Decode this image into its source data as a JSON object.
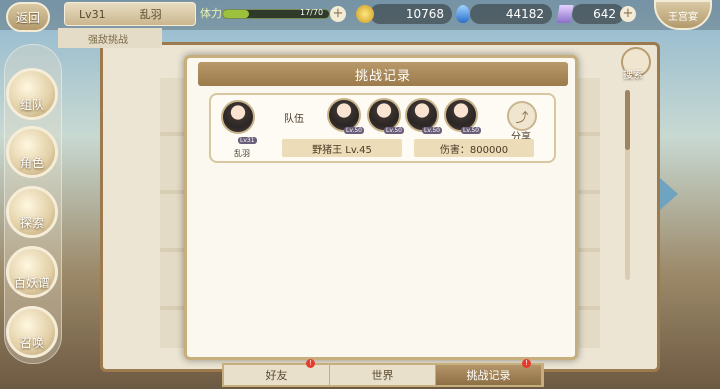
{
  "top": {
    "back_label": "返回",
    "player_level": "Lv31",
    "player_name": "乱羽",
    "stamina_label": "体力",
    "stamina_text": "17/70",
    "stamina_fraction": 0.243,
    "gold": "10768",
    "water": "44182",
    "gem": "642",
    "sub_tab": "强敌挑战",
    "right_btn": "王宫宴"
  },
  "side_menu": [
    {
      "label": "组队",
      "icon": "cat-icon"
    },
    {
      "label": "角色",
      "icon": "character-icon"
    },
    {
      "label": "探索",
      "icon": "explore-icon"
    },
    {
      "label": "百妖谱",
      "icon": "book-icon"
    },
    {
      "label": "召唤",
      "icon": "summon-icon"
    }
  ],
  "search_label": "搜索",
  "modal": {
    "title": "挑战记录",
    "record": {
      "player_name": "乱羽",
      "player_level": "Lv31",
      "team_label": "队伍",
      "team_levels": [
        "Lv.50",
        "Lv.50",
        "Lv.50",
        "Lv.50"
      ],
      "boss": "野猪王  Lv.45",
      "damage": "伤害：800000",
      "share_label": "分享"
    }
  },
  "tabs": [
    {
      "label": "好友",
      "badge": "!"
    },
    {
      "label": "世界",
      "badge": ""
    },
    {
      "label": "挑战记录",
      "badge": "!"
    }
  ]
}
